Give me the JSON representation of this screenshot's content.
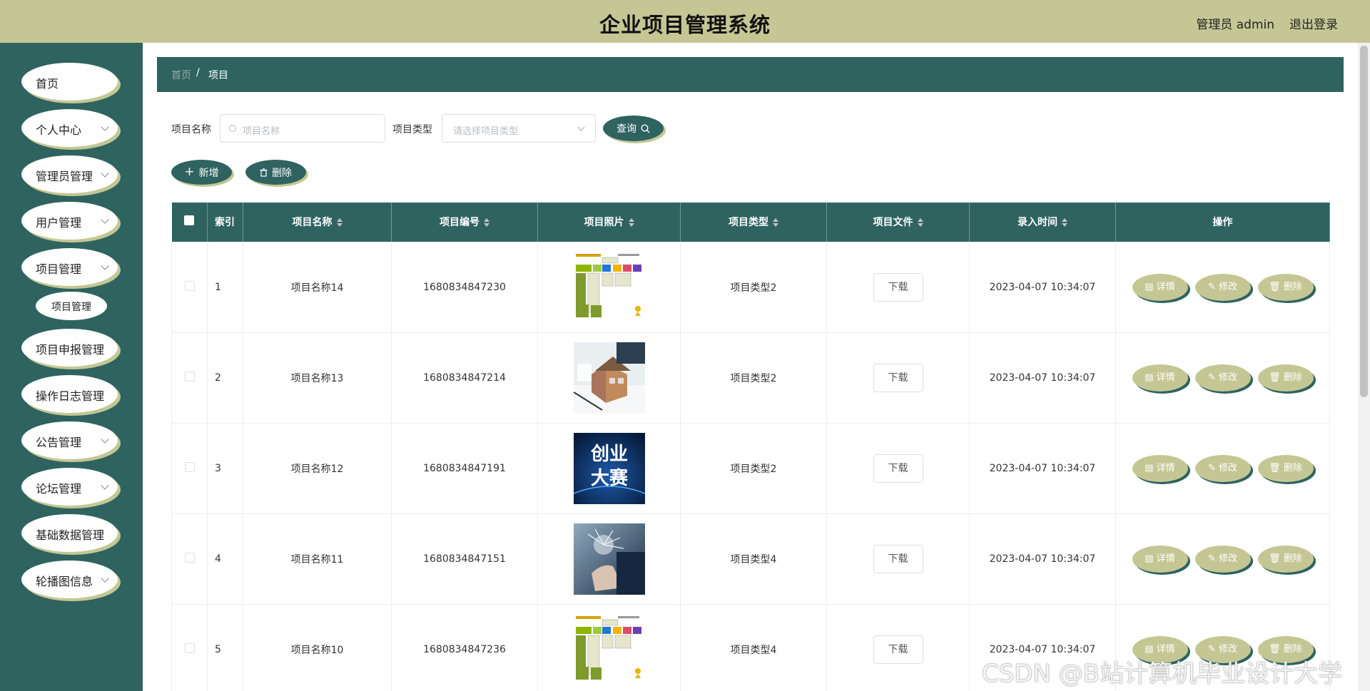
{
  "header": {
    "title": "企业项目管理系统",
    "user": "管理员 admin",
    "logout": "退出登录"
  },
  "sidebar": {
    "items": [
      {
        "label": "首页",
        "has_chevron": false
      },
      {
        "label": "个人中心",
        "has_chevron": true
      },
      {
        "label": "管理员管理",
        "has_chevron": true
      },
      {
        "label": "用户管理",
        "has_chevron": true
      },
      {
        "label": "项目管理",
        "has_chevron": true
      },
      {
        "label": "项目申报管理",
        "has_chevron": false
      },
      {
        "label": "操作日志管理",
        "has_chevron": false
      },
      {
        "label": "公告管理",
        "has_chevron": true
      },
      {
        "label": "论坛管理",
        "has_chevron": true
      },
      {
        "label": "基础数据管理",
        "has_chevron": false
      },
      {
        "label": "轮播图信息",
        "has_chevron": true
      }
    ],
    "submenu": {
      "label": "项目管理"
    }
  },
  "breadcrumb": {
    "home": "首页",
    "separator": "/",
    "current": "项目"
  },
  "search": {
    "name_label": "项目名称",
    "name_placeholder": "项目名称",
    "type_label": "项目类型",
    "type_placeholder": "请选择项目类型",
    "query_button": "查询"
  },
  "actions": {
    "add": "新增",
    "delete": "删除"
  },
  "table": {
    "columns": [
      "索引",
      "项目名称",
      "项目编号",
      "项目照片",
      "项目类型",
      "项目文件",
      "录入时间",
      "操作"
    ],
    "rows": [
      {
        "index": "1",
        "name": "项目名称14",
        "code": "1680834847230",
        "photo": "flowchart",
        "type": "项目类型2",
        "file": "下载",
        "time": "2023-04-07 10:34:07"
      },
      {
        "index": "2",
        "name": "项目名称13",
        "code": "1680834847214",
        "photo": "house-model",
        "type": "项目类型2",
        "file": "下载",
        "time": "2023-04-07 10:34:07"
      },
      {
        "index": "3",
        "name": "项目名称12",
        "code": "1680834847191",
        "photo": "poster",
        "type": "项目类型2",
        "file": "下载",
        "time": "2023-04-07 10:34:07"
      },
      {
        "index": "4",
        "name": "项目名称11",
        "code": "1680834847151",
        "photo": "tech-hand",
        "type": "项目类型4",
        "file": "下载",
        "time": "2023-04-07 10:34:07"
      },
      {
        "index": "5",
        "name": "项目名称10",
        "code": "1680834847236",
        "photo": "flowchart",
        "type": "项目类型4",
        "file": "下载",
        "time": "2023-04-07 10:34:07"
      }
    ],
    "row_actions": {
      "detail": "详情",
      "edit": "修改",
      "delete": "删除"
    },
    "poster_text": [
      "创业",
      "大赛"
    ]
  },
  "watermark": "CSDN @B站计算机毕业设计大学",
  "colors": {
    "primary": "#2e6360",
    "accent": "#c4c794"
  }
}
